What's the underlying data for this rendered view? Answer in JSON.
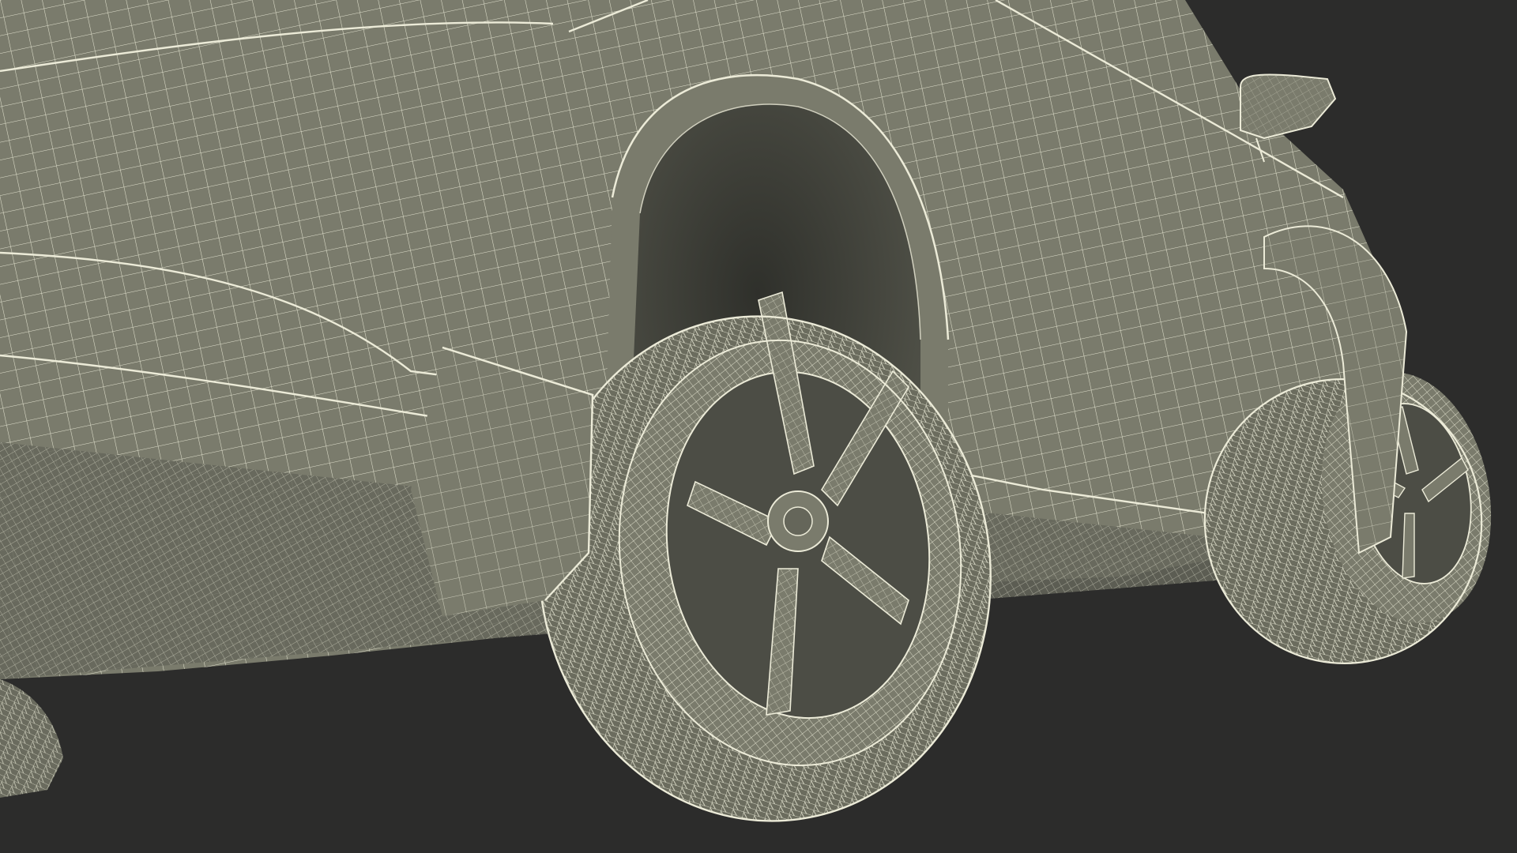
{
  "scene": {
    "subject": "wireframe-car-render",
    "colors": {
      "background": "#2c2c2b",
      "surface": "#7a7b6c",
      "surface_dark": "#65665a",
      "surface_shadow": "#4a4b43",
      "wheel_well": "#3e3f39",
      "wire": "#ecebd8"
    }
  }
}
